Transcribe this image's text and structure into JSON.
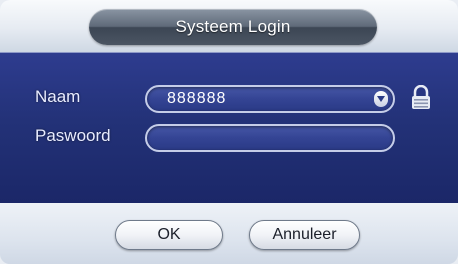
{
  "dialog": {
    "title": "Systeem Login"
  },
  "form": {
    "name_label": "Naam",
    "name_value": "888888",
    "password_label": "Paswoord",
    "password_value": ""
  },
  "icons": {
    "dropdown": "chevron-down-icon",
    "lock": "lock-icon"
  },
  "buttons": {
    "ok_label": "OK",
    "cancel_label": "Annuleer"
  },
  "colors": {
    "panel_blue": "#233278",
    "field_border": "#c5cde8",
    "title_pill": "#4b5563"
  }
}
